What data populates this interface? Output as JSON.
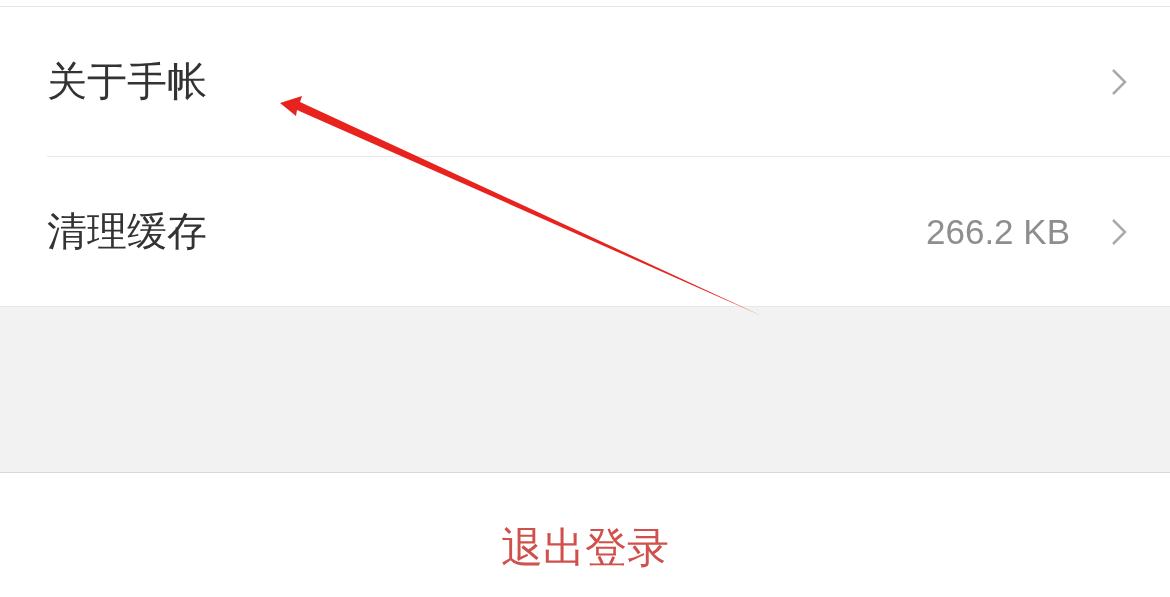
{
  "settings": [
    {
      "label": "关于手帐"
    },
    {
      "label": "清理缓存",
      "value": "266.2 KB"
    }
  ],
  "logout": {
    "label": "退出登录"
  }
}
